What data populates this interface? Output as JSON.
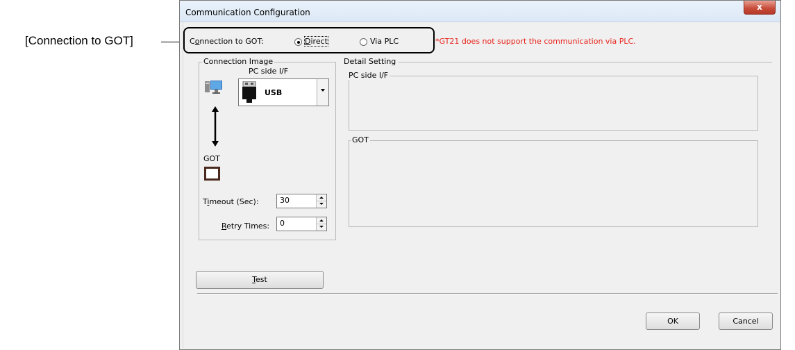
{
  "callout": {
    "label": "[Connection to GOT]"
  },
  "window": {
    "title": "Communication Configuration",
    "close_label": "x"
  },
  "connection": {
    "label_pre": "C",
    "label_mn": "o",
    "label_post": "nnection to GOT:",
    "options": [
      {
        "mn": "D",
        "rest": "irect",
        "selected": true
      },
      {
        "mn": "",
        "rest": "Via PLC",
        "selected": false
      }
    ],
    "warning": "*GT21 does not support the communication via PLC."
  },
  "connection_image": {
    "group_title": "Connection Image",
    "pc_side_label": "PC side I/F",
    "interface_value": "USB",
    "got_label": "GOT",
    "timeout": {
      "label_pre": "T",
      "label_mn": "i",
      "label_post": "meout (Sec):",
      "value": "30"
    },
    "retry": {
      "label_pre": "",
      "label_mn": "R",
      "label_post": "etry Times:",
      "value": "0"
    }
  },
  "detail_setting": {
    "group_title": "Detail Setting",
    "pc_side_title": "PC side I/F",
    "got_title": "GOT"
  },
  "buttons": {
    "test_mn": "T",
    "test_rest": "est",
    "ok": "OK",
    "cancel": "Cancel"
  },
  "colors": {
    "warning": "#e8231b",
    "highlight_border": "#000000",
    "dialog_bg": "#f0f0f0"
  }
}
